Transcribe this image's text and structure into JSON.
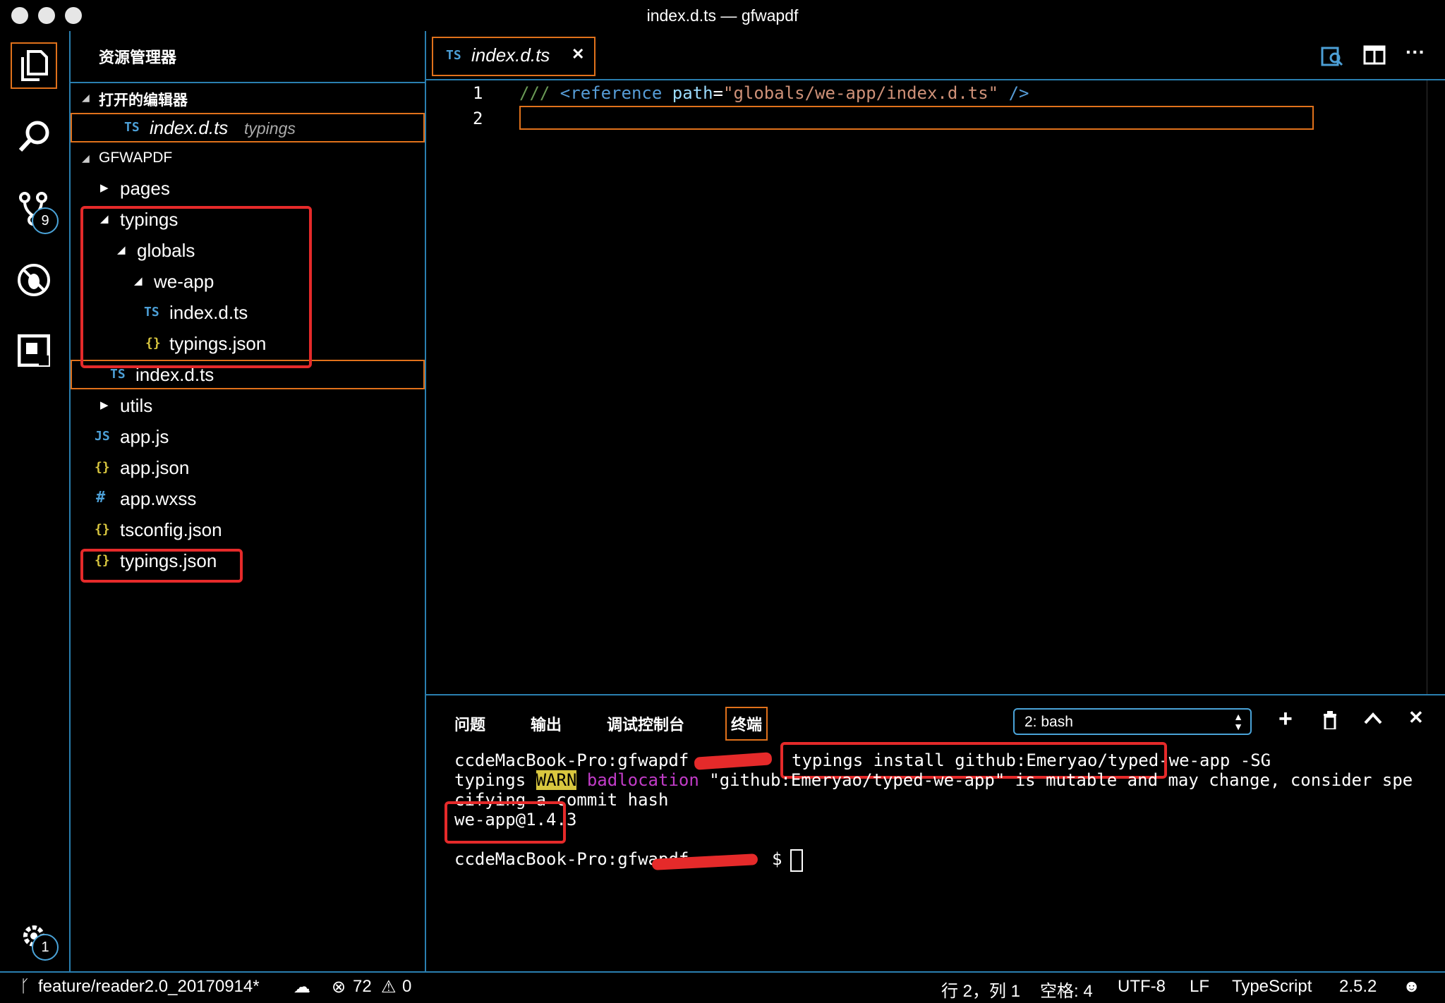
{
  "window": {
    "title": "index.d.ts — gfwapdf"
  },
  "activity_bar": {
    "items": [
      {
        "name": "explorer-icon",
        "badge": ""
      },
      {
        "name": "search-icon",
        "badge": ""
      },
      {
        "name": "source-control-icon",
        "badge": "9"
      },
      {
        "name": "debug-icon",
        "badge": ""
      },
      {
        "name": "extensions-icon",
        "badge": ""
      }
    ],
    "settings_badge": "1"
  },
  "sidebar": {
    "title": "资源管理器",
    "open_editors": {
      "label": "打开的编辑器",
      "items": [
        {
          "icon": "TS",
          "name": "index.d.ts",
          "path": "typings"
        }
      ]
    },
    "project": {
      "label": "GFWAPDF",
      "tree": [
        {
          "icon": "",
          "label": "pages",
          "kind": "folder-closed"
        },
        {
          "icon": "",
          "label": "typings",
          "kind": "folder-open"
        },
        {
          "icon": "",
          "label": "globals",
          "kind": "folder-open"
        },
        {
          "icon": "",
          "label": "we-app",
          "kind": "folder-open"
        },
        {
          "icon": "TS",
          "label": "index.d.ts",
          "kind": "file"
        },
        {
          "icon": "{}",
          "label": "typings.json",
          "kind": "file"
        },
        {
          "icon": "TS",
          "label": "index.d.ts",
          "kind": "file"
        },
        {
          "icon": "",
          "label": "utils",
          "kind": "folder-closed"
        },
        {
          "icon": "JS",
          "label": "app.js",
          "kind": "file"
        },
        {
          "icon": "{}",
          "label": "app.json",
          "kind": "file"
        },
        {
          "icon": "#",
          "label": "app.wxss",
          "kind": "file"
        },
        {
          "icon": "{}",
          "label": "tsconfig.json",
          "kind": "file"
        },
        {
          "icon": "{}",
          "label": "typings.json",
          "kind": "file"
        }
      ]
    }
  },
  "editor": {
    "tab": {
      "icon": "TS",
      "label": "index.d.ts",
      "close": "✕"
    },
    "lines": [
      {
        "number": "1",
        "comment": "/// ",
        "tag_open": "<reference ",
        "attr": "path",
        "eq": "=",
        "value": "\"globals/we-app/index.d.ts\"",
        "tag_close": " />"
      },
      {
        "number": "2"
      }
    ]
  },
  "panel": {
    "tabs": [
      "问题",
      "输出",
      "调试控制台",
      "终端"
    ],
    "active_tab": "终端",
    "terminal_select": "2: bash",
    "terminal": {
      "line1_prompt": "ccdeMacBook-Pro:gfwapdf",
      "line1_cmd": "typings install github:Emeryao/typed-we-app -SG",
      "line2_prefix": "typings ",
      "line2_warn": "WARN",
      "line2_loc": "badlocation",
      "line2_rest": "\"github:Emeryao/typed-we-app\" is mutable and may change, consider spe",
      "line3": "cifying a commit hash",
      "line4": "we-app@1.4.3",
      "line5_prompt": "ccdeMacBook-Pro:gfwapdf",
      "line5_dollar": "$"
    }
  },
  "status_bar": {
    "branch": "feature/reader2.0_20170914*",
    "errors": "72",
    "warnings": "0",
    "position": "行 2，列 1",
    "spaces": "空格: 4",
    "encoding": "UTF-8",
    "eol": "LF",
    "language": "TypeScript",
    "version": "2.5.2"
  },
  "colors": {
    "accent_border": "#2a7fb0",
    "highlight": "#e0711b",
    "annotation": "#e52a2a"
  }
}
